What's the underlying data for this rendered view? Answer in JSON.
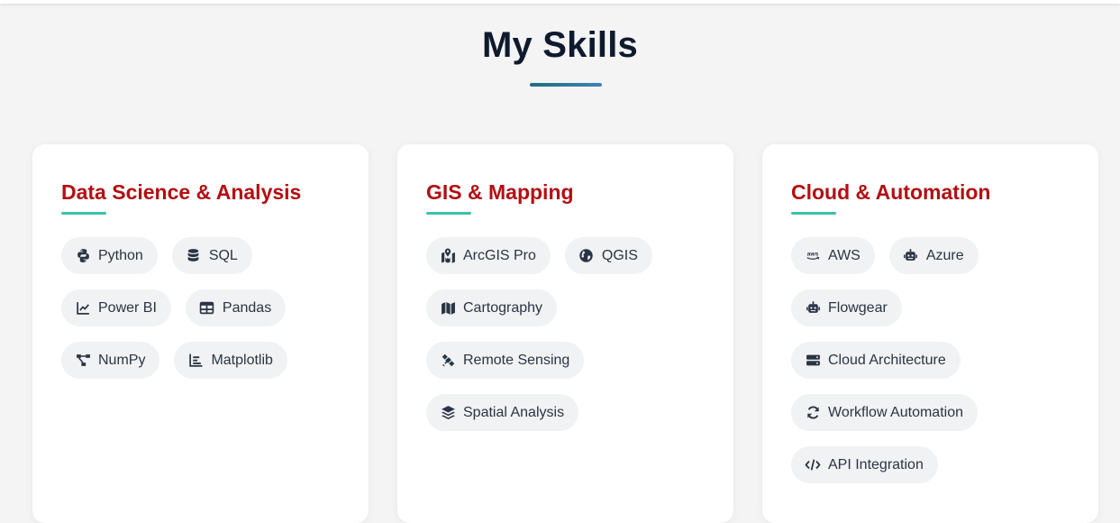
{
  "section": {
    "title": "My Skills"
  },
  "colors": {
    "title": "#0e1a2e",
    "card_title": "#b30e12",
    "accent_underline": "#3ebfa8",
    "chip_bg": "#f1f2f3",
    "chip_text": "#2a3444"
  },
  "cards": [
    {
      "title": "Data Science & Analysis",
      "skills": [
        {
          "label": "Python",
          "icon": "python-icon"
        },
        {
          "label": "SQL",
          "icon": "database-icon"
        },
        {
          "label": "Power BI",
          "icon": "line-chart-icon"
        },
        {
          "label": "Pandas",
          "icon": "table-icon"
        },
        {
          "label": "NumPy",
          "icon": "project-diagram-icon"
        },
        {
          "label": "Matplotlib",
          "icon": "bar-chart-icon"
        }
      ]
    },
    {
      "title": "GIS & Mapping",
      "skills": [
        {
          "label": "ArcGIS Pro",
          "icon": "map-marked-icon"
        },
        {
          "label": "QGIS",
          "icon": "globe-icon"
        },
        {
          "label": "Cartography",
          "icon": "map-icon"
        },
        {
          "label": "Remote Sensing",
          "icon": "satellite-icon"
        },
        {
          "label": "Spatial Analysis",
          "icon": "layers-icon"
        }
      ]
    },
    {
      "title": "Cloud & Automation",
      "skills": [
        {
          "label": "AWS",
          "icon": "aws-icon"
        },
        {
          "label": "Azure",
          "icon": "robot-icon"
        },
        {
          "label": "Flowgear",
          "icon": "robot-icon"
        },
        {
          "label": "Cloud Architecture",
          "icon": "server-icon"
        },
        {
          "label": "Workflow Automation",
          "icon": "sync-icon"
        },
        {
          "label": "API Integration",
          "icon": "code-icon"
        }
      ]
    }
  ]
}
